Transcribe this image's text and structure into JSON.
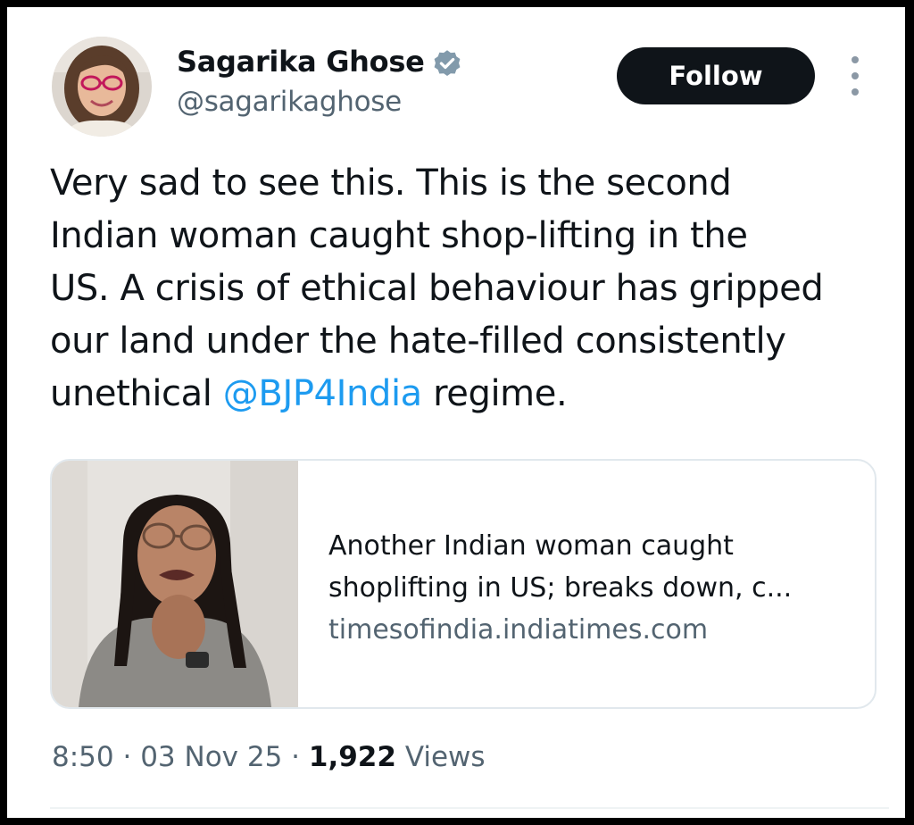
{
  "author": {
    "display_name": "Sagarika Ghose",
    "handle": "@sagarikaghose",
    "verified": true,
    "avatar": "profile-photo"
  },
  "actions": {
    "follow_label": "Follow",
    "more_icon": "more-vertical-icon"
  },
  "tweet": {
    "lines": [
      "Very sad to see this. This is the second",
      "Indian woman caught shop-lifting in the",
      "US. A crisis of ethical behaviour has gripped",
      "our land under the hate-filled consistently"
    ],
    "last_line_before": "unethical ",
    "mention": "@BJP4India",
    "last_line_after": " regime."
  },
  "link_card": {
    "title_line_1": "Another Indian woman caught",
    "title_line_2": "shoplifting in US; breaks down, c...",
    "domain": "timesofindia.indiatimes.com",
    "thumbnail": "woman-crying-photo"
  },
  "meta": {
    "time": "8:50",
    "separator": "·",
    "date": "03 Nov 25",
    "views_count": "1,922",
    "views_label": "Views"
  },
  "colors": {
    "text": "#0f1419",
    "secondary": "#536471",
    "link": "#1d9bf0",
    "verified_badge": "#829aab",
    "follow_bg": "#0f1419"
  }
}
